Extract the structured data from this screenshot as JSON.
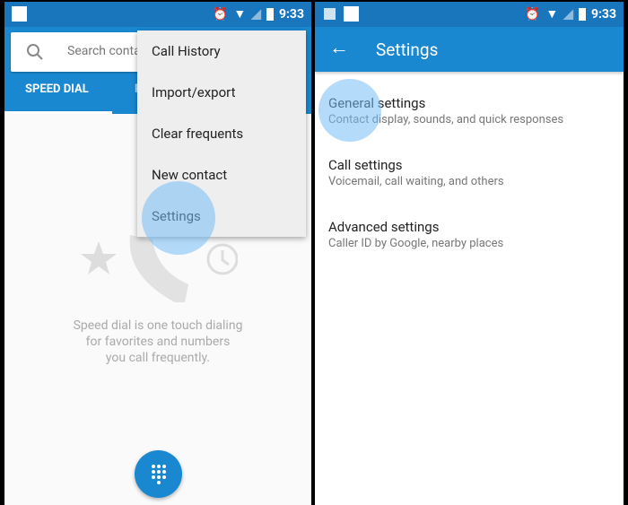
{
  "status": {
    "time": "9:33"
  },
  "left": {
    "search_placeholder": "Search conta",
    "tabs": [
      "SPEED DIAL",
      "R"
    ],
    "menu": [
      "Call History",
      "Import/export",
      "Clear frequents",
      "New contact",
      "Settings"
    ],
    "empty_text": [
      "Speed dial is one touch dialing",
      "for favorites and numbers",
      "you call frequently."
    ]
  },
  "right": {
    "title": "Settings",
    "items": [
      {
        "title": "General settings",
        "subtitle": "Contact display, sounds, and quick responses"
      },
      {
        "title": "Call settings",
        "subtitle": "Voicemail, call waiting, and others"
      },
      {
        "title": "Advanced settings",
        "subtitle": "Caller ID by Google, nearby places"
      }
    ]
  },
  "colors": {
    "status": "#1976bd",
    "appbar": "#1a88d0",
    "touch": "#78bef5"
  }
}
